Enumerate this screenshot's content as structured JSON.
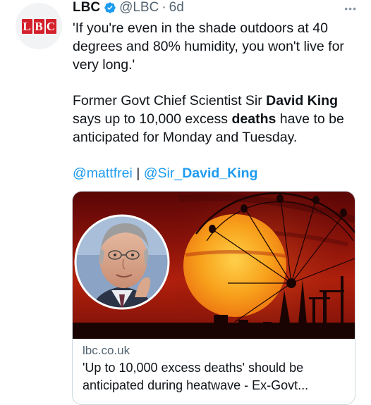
{
  "tweet": {
    "author_name": "LBC",
    "handle": "@LBC",
    "separator": "·",
    "time": "6d",
    "avatar_logo_letters": [
      "L",
      "B",
      "C"
    ],
    "more_icon": "more-dots-icon",
    "quote_text": "'If you're even in the shade outdoors at 40 degrees and 80% humidity, you won't live for very long.'",
    "para_prefix": "Former Govt Chief Scientist Sir ",
    "para_bold_1": "David King",
    "para_middle": " says up to 10,000 excess ",
    "para_bold_2": "deaths",
    "para_suffix": " have to be anticipated for Monday and Tuesday.",
    "mention_1": "@mattfrei",
    "mention_sep": " | ",
    "mention_2_prefix": "@Sir_",
    "mention_2_bold": "David_King"
  },
  "card": {
    "domain": "lbc.co.uk",
    "title": "'Up to 10,000 excess deaths' should be anticipated during heatwave - Ex-Govt..."
  },
  "colors": {
    "link": "#1d9bf0",
    "brand_red": "#d3202a",
    "secondary_text": "#536471"
  }
}
